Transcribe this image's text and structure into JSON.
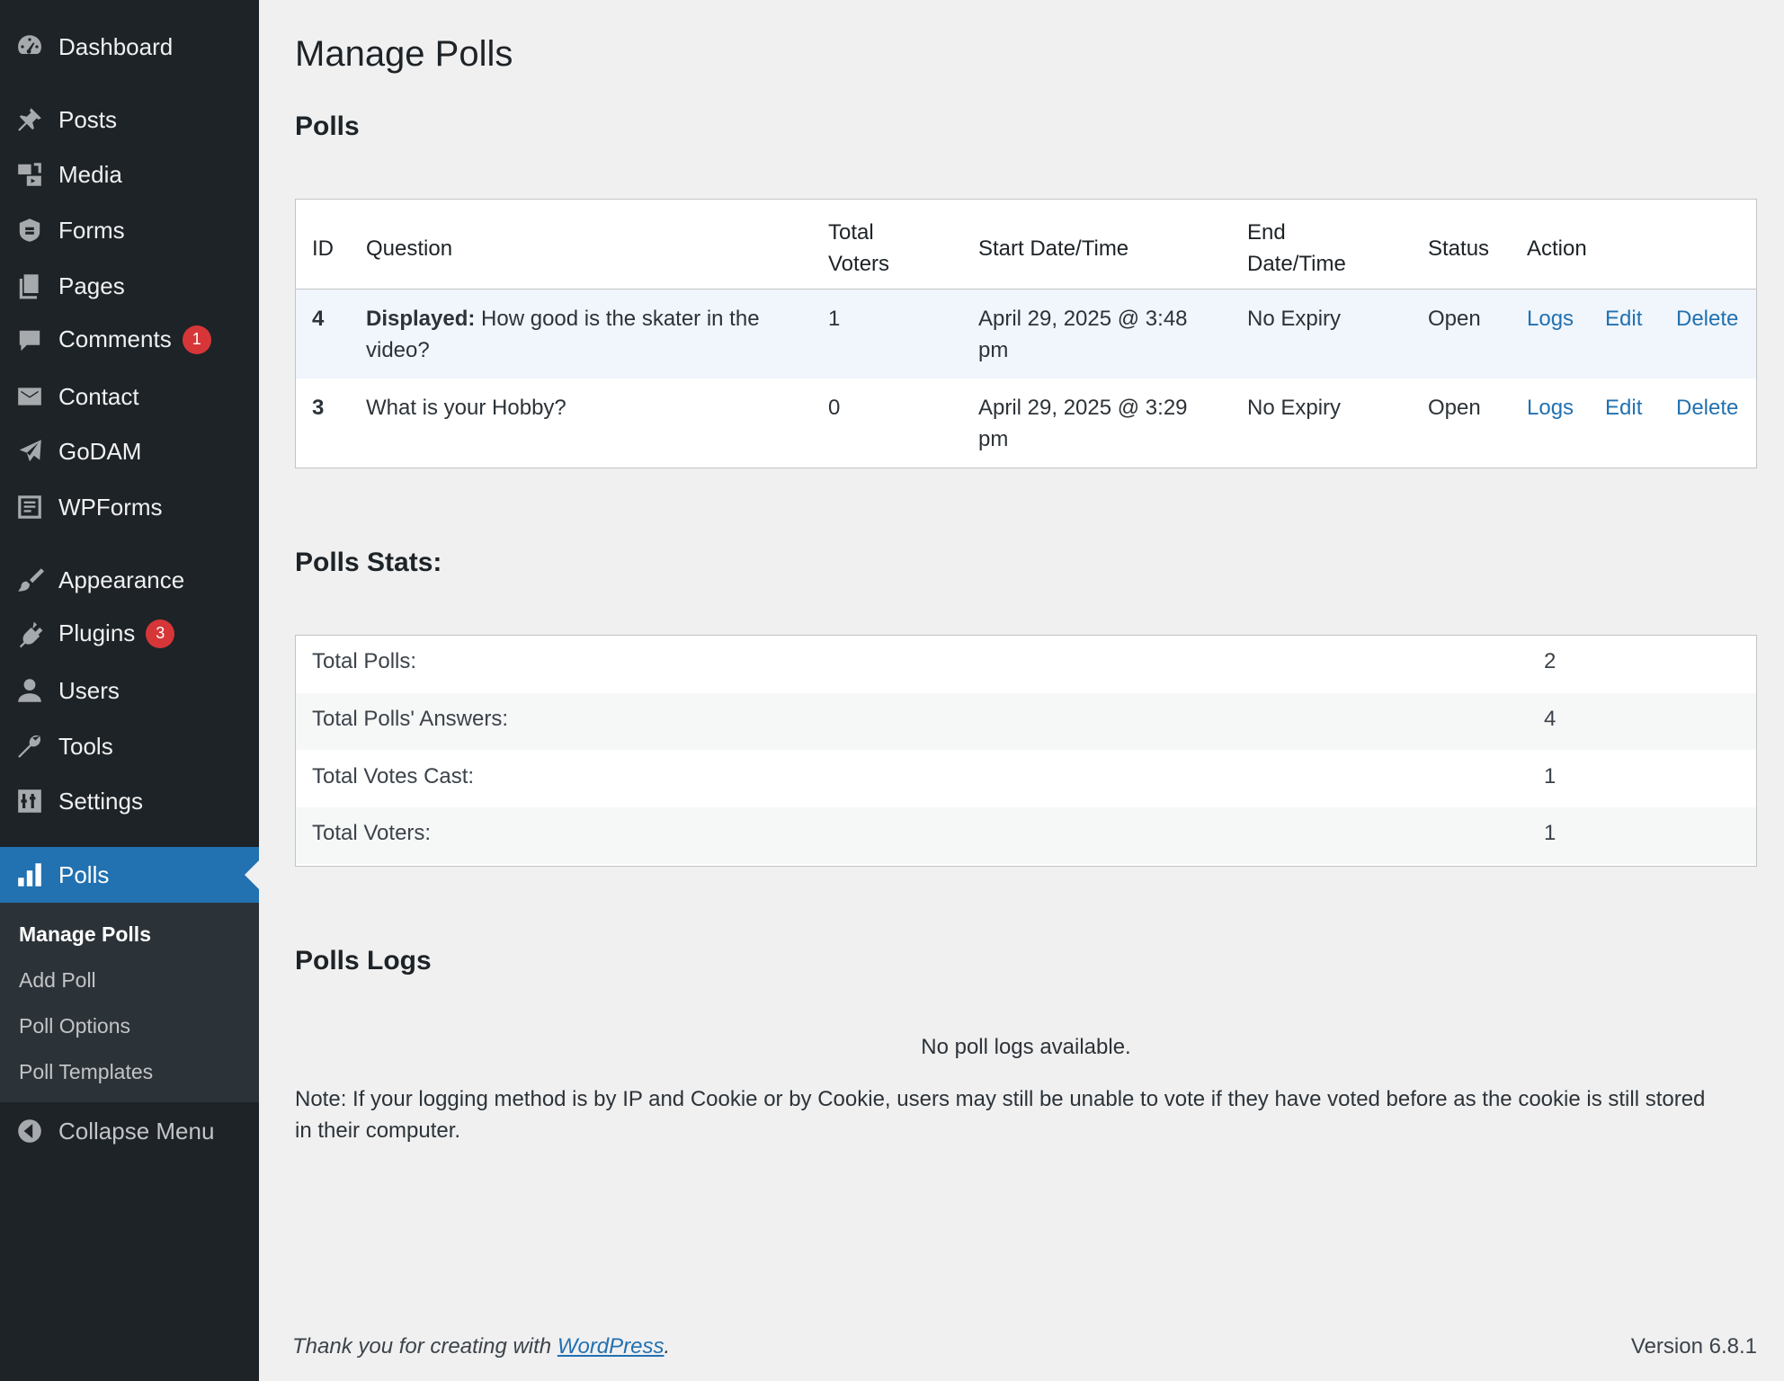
{
  "sidebar": {
    "items": [
      {
        "label": "Dashboard",
        "icon": "dashboard-icon"
      },
      {
        "label": "Posts",
        "icon": "pushpin-icon"
      },
      {
        "label": "Media",
        "icon": "media-icon"
      },
      {
        "label": "Forms",
        "icon": "forms-icon"
      },
      {
        "label": "Pages",
        "icon": "pages-icon"
      },
      {
        "label": "Comments",
        "icon": "comment-icon",
        "badge": "1"
      },
      {
        "label": "Contact",
        "icon": "envelope-icon"
      },
      {
        "label": "GoDAM",
        "icon": "godam-icon"
      },
      {
        "label": "WPForms",
        "icon": "wpforms-icon"
      },
      {
        "label": "Appearance",
        "icon": "paintbrush-icon"
      },
      {
        "label": "Plugins",
        "icon": "plug-icon",
        "badge": "3"
      },
      {
        "label": "Users",
        "icon": "user-icon"
      },
      {
        "label": "Tools",
        "icon": "wrench-icon"
      },
      {
        "label": "Settings",
        "icon": "sliders-icon"
      },
      {
        "label": "Polls",
        "icon": "bar-chart-icon"
      }
    ],
    "submenu": [
      "Manage Polls",
      "Add Poll",
      "Poll Options",
      "Poll Templates"
    ],
    "collapse_label": "Collapse Menu"
  },
  "page": {
    "title": "Manage Polls",
    "polls_heading": "Polls",
    "stats_heading": "Polls Stats:",
    "logs_heading": "Polls Logs"
  },
  "polls_table": {
    "headers": {
      "id": "ID",
      "question": "Question",
      "voters_1": "Total",
      "voters_2": "Voters",
      "start": "Start Date/Time",
      "end_1": "End",
      "end_2": "Date/Time",
      "status": "Status",
      "action": "Action"
    },
    "rows": [
      {
        "id": "4",
        "question_prefix": "Displayed:",
        "question_line1": " How good is the skater in the",
        "question_line2": "video?",
        "voters": "1",
        "start_line1": "April 29, 2025 @ 3:48",
        "start_line2": "pm",
        "end": "No Expiry",
        "status": "Open",
        "logs": "Logs",
        "edit": "Edit",
        "delete": "Delete"
      },
      {
        "id": "3",
        "question_line1": "What is your Hobby?",
        "voters": "0",
        "start_line1": "April 29, 2025 @ 3:29",
        "start_line2": "pm",
        "end": "No Expiry",
        "status": "Open",
        "logs": "Logs",
        "edit": "Edit",
        "delete": "Delete"
      }
    ]
  },
  "stats": [
    {
      "label": "Total Polls:",
      "value": "2"
    },
    {
      "label": "Total Polls' Answers:",
      "value": "4"
    },
    {
      "label": "Total Votes Cast:",
      "value": "1"
    },
    {
      "label": "Total Voters:",
      "value": "1"
    }
  ],
  "logs": {
    "empty_message": "No poll logs available.",
    "note_line1": "Note: If your logging method is by IP and Cookie or by Cookie, users may still be unable to vote if they have voted before as the cookie is still stored",
    "note_line2": "in their computer."
  },
  "footer": {
    "thanks_prefix": "Thank you for creating with ",
    "wordpress_link": "WordPress",
    "thanks_suffix": ".",
    "version": "Version 6.8.1"
  },
  "colors": {
    "sidebar_bg": "#1d2327",
    "active_bg": "#2271b1",
    "badge_bg": "#d63638",
    "link": "#2271b1",
    "page_bg": "#f0f0f1"
  }
}
